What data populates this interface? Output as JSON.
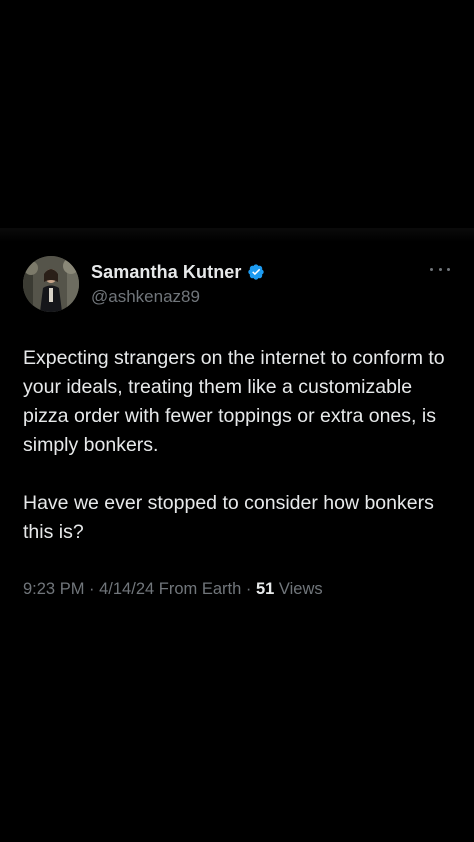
{
  "tweet": {
    "author": {
      "display_name": "Samantha Kutner",
      "handle": "@ashkenaz89",
      "verified": true,
      "verified_color": "#1d9bf0"
    },
    "text": {
      "paragraph1": "Expecting strangers on the internet to conform to your ideals, treating them like a customizable pizza order with fewer toppings or extra ones, is simply bonkers.",
      "paragraph2": "Have we ever stopped to consider how bonkers this is?"
    },
    "meta": {
      "time": "9:23 PM",
      "separator1": " · ",
      "date": "4/14/24",
      "source": " From Earth",
      "separator2": " · ",
      "views_count": "51",
      "views_label": " Views"
    },
    "icons": {
      "verified": "verified-badge-icon",
      "more": "more-dots-icon"
    }
  },
  "colors": {
    "background": "#000000",
    "primary_text": "#e7e9ea",
    "secondary_text": "#71767b"
  }
}
